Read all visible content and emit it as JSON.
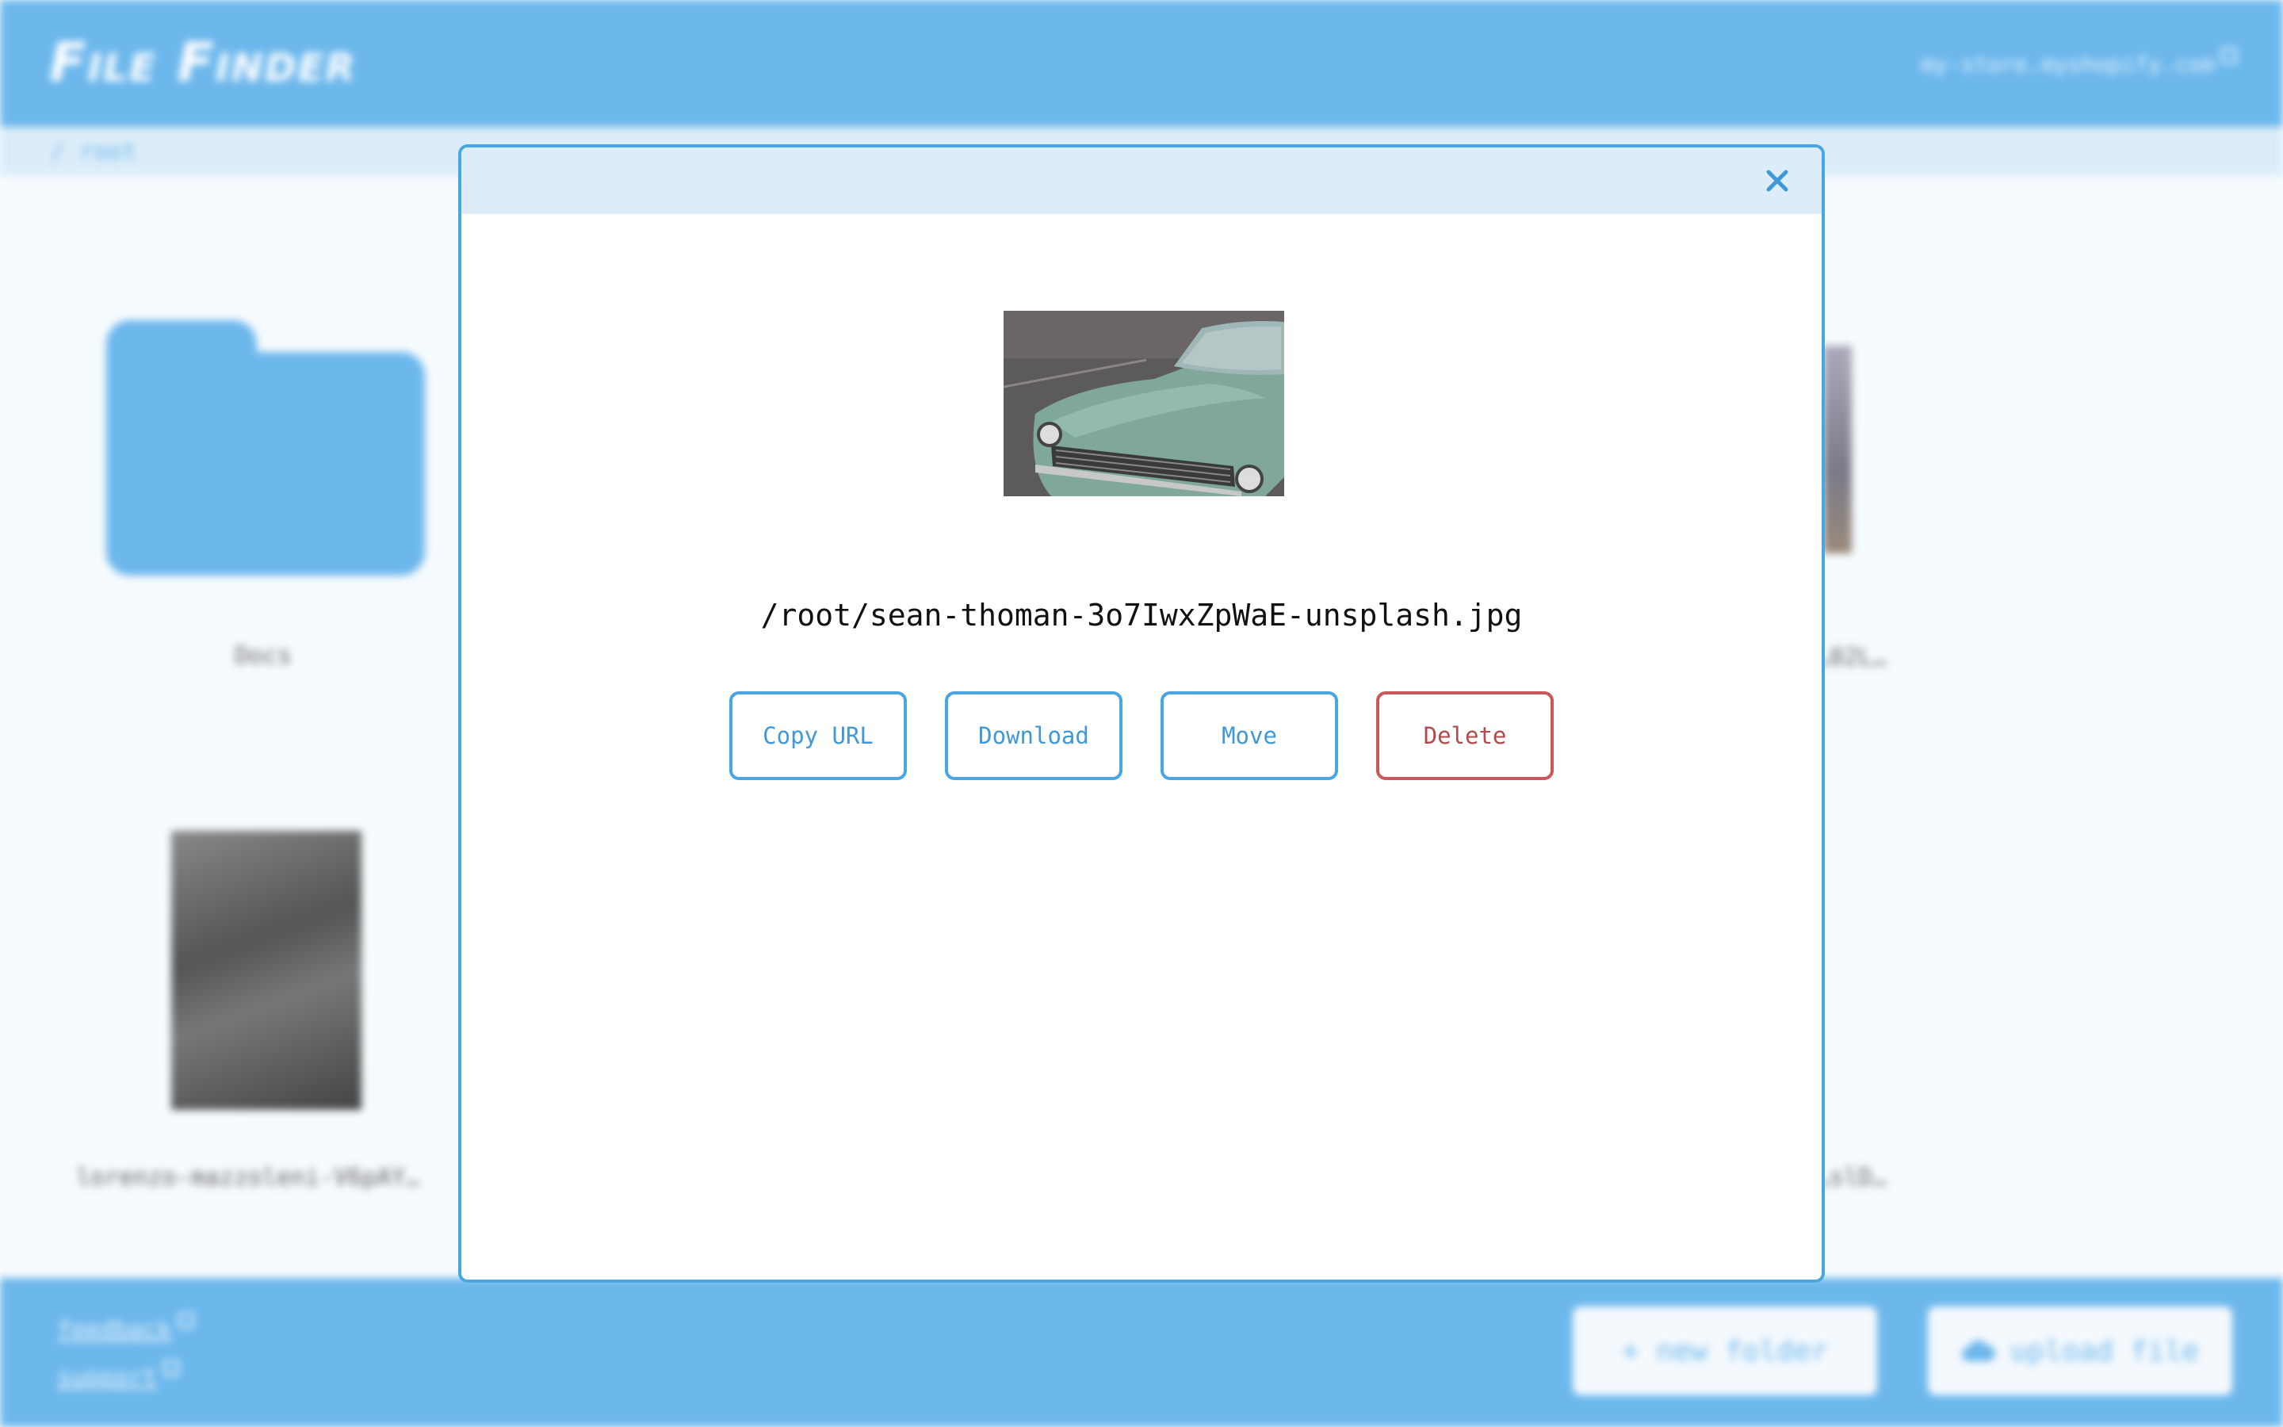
{
  "app": {
    "title": "File Finder",
    "store_link": "my-store.myshopify.com",
    "breadcrumb": "/ root"
  },
  "grid": {
    "items": [
      {
        "label": "Docs",
        "type": "folder"
      },
      {
        "label": "lorenzo-mazzoleni-V6pAY…",
        "type": "image"
      },
      {
        "label": "…02L…",
        "type": "image"
      },
      {
        "label": "…slD…",
        "type": "image"
      }
    ]
  },
  "footer": {
    "feedback_label": "feedback",
    "support_label": "support",
    "new_folder_label": "+ new folder",
    "upload_file_label": "upload file"
  },
  "modal": {
    "file_path": "/root/sean-thoman-3o7IwxZpWaE-unsplash.jpg",
    "buttons": {
      "copy_url": "Copy URL",
      "download": "Download",
      "move": "Move",
      "delete": "Delete"
    }
  },
  "colors": {
    "accent": "#6cb7ec",
    "modal_border": "#4aa6df",
    "danger": "#c9585a"
  },
  "icons": {
    "close": "close-icon",
    "external": "external-link-icon",
    "cloud": "cloud-upload-icon"
  }
}
